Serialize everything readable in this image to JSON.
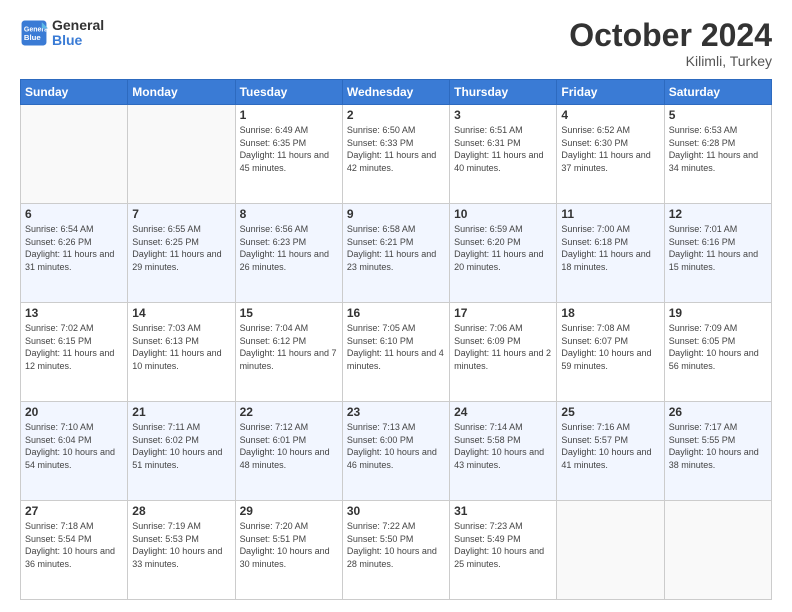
{
  "logo": {
    "line1": "General",
    "line2": "Blue"
  },
  "header": {
    "month": "October 2024",
    "location": "Kilimli, Turkey"
  },
  "days_of_week": [
    "Sunday",
    "Monday",
    "Tuesday",
    "Wednesday",
    "Thursday",
    "Friday",
    "Saturday"
  ],
  "weeks": [
    [
      {
        "day": "",
        "info": ""
      },
      {
        "day": "",
        "info": ""
      },
      {
        "day": "1",
        "info": "Sunrise: 6:49 AM\nSunset: 6:35 PM\nDaylight: 11 hours and 45 minutes."
      },
      {
        "day": "2",
        "info": "Sunrise: 6:50 AM\nSunset: 6:33 PM\nDaylight: 11 hours and 42 minutes."
      },
      {
        "day": "3",
        "info": "Sunrise: 6:51 AM\nSunset: 6:31 PM\nDaylight: 11 hours and 40 minutes."
      },
      {
        "day": "4",
        "info": "Sunrise: 6:52 AM\nSunset: 6:30 PM\nDaylight: 11 hours and 37 minutes."
      },
      {
        "day": "5",
        "info": "Sunrise: 6:53 AM\nSunset: 6:28 PM\nDaylight: 11 hours and 34 minutes."
      }
    ],
    [
      {
        "day": "6",
        "info": "Sunrise: 6:54 AM\nSunset: 6:26 PM\nDaylight: 11 hours and 31 minutes."
      },
      {
        "day": "7",
        "info": "Sunrise: 6:55 AM\nSunset: 6:25 PM\nDaylight: 11 hours and 29 minutes."
      },
      {
        "day": "8",
        "info": "Sunrise: 6:56 AM\nSunset: 6:23 PM\nDaylight: 11 hours and 26 minutes."
      },
      {
        "day": "9",
        "info": "Sunrise: 6:58 AM\nSunset: 6:21 PM\nDaylight: 11 hours and 23 minutes."
      },
      {
        "day": "10",
        "info": "Sunrise: 6:59 AM\nSunset: 6:20 PM\nDaylight: 11 hours and 20 minutes."
      },
      {
        "day": "11",
        "info": "Sunrise: 7:00 AM\nSunset: 6:18 PM\nDaylight: 11 hours and 18 minutes."
      },
      {
        "day": "12",
        "info": "Sunrise: 7:01 AM\nSunset: 6:16 PM\nDaylight: 11 hours and 15 minutes."
      }
    ],
    [
      {
        "day": "13",
        "info": "Sunrise: 7:02 AM\nSunset: 6:15 PM\nDaylight: 11 hours and 12 minutes."
      },
      {
        "day": "14",
        "info": "Sunrise: 7:03 AM\nSunset: 6:13 PM\nDaylight: 11 hours and 10 minutes."
      },
      {
        "day": "15",
        "info": "Sunrise: 7:04 AM\nSunset: 6:12 PM\nDaylight: 11 hours and 7 minutes."
      },
      {
        "day": "16",
        "info": "Sunrise: 7:05 AM\nSunset: 6:10 PM\nDaylight: 11 hours and 4 minutes."
      },
      {
        "day": "17",
        "info": "Sunrise: 7:06 AM\nSunset: 6:09 PM\nDaylight: 11 hours and 2 minutes."
      },
      {
        "day": "18",
        "info": "Sunrise: 7:08 AM\nSunset: 6:07 PM\nDaylight: 10 hours and 59 minutes."
      },
      {
        "day": "19",
        "info": "Sunrise: 7:09 AM\nSunset: 6:05 PM\nDaylight: 10 hours and 56 minutes."
      }
    ],
    [
      {
        "day": "20",
        "info": "Sunrise: 7:10 AM\nSunset: 6:04 PM\nDaylight: 10 hours and 54 minutes."
      },
      {
        "day": "21",
        "info": "Sunrise: 7:11 AM\nSunset: 6:02 PM\nDaylight: 10 hours and 51 minutes."
      },
      {
        "day": "22",
        "info": "Sunrise: 7:12 AM\nSunset: 6:01 PM\nDaylight: 10 hours and 48 minutes."
      },
      {
        "day": "23",
        "info": "Sunrise: 7:13 AM\nSunset: 6:00 PM\nDaylight: 10 hours and 46 minutes."
      },
      {
        "day": "24",
        "info": "Sunrise: 7:14 AM\nSunset: 5:58 PM\nDaylight: 10 hours and 43 minutes."
      },
      {
        "day": "25",
        "info": "Sunrise: 7:16 AM\nSunset: 5:57 PM\nDaylight: 10 hours and 41 minutes."
      },
      {
        "day": "26",
        "info": "Sunrise: 7:17 AM\nSunset: 5:55 PM\nDaylight: 10 hours and 38 minutes."
      }
    ],
    [
      {
        "day": "27",
        "info": "Sunrise: 7:18 AM\nSunset: 5:54 PM\nDaylight: 10 hours and 36 minutes."
      },
      {
        "day": "28",
        "info": "Sunrise: 7:19 AM\nSunset: 5:53 PM\nDaylight: 10 hours and 33 minutes."
      },
      {
        "day": "29",
        "info": "Sunrise: 7:20 AM\nSunset: 5:51 PM\nDaylight: 10 hours and 30 minutes."
      },
      {
        "day": "30",
        "info": "Sunrise: 7:22 AM\nSunset: 5:50 PM\nDaylight: 10 hours and 28 minutes."
      },
      {
        "day": "31",
        "info": "Sunrise: 7:23 AM\nSunset: 5:49 PM\nDaylight: 10 hours and 25 minutes."
      },
      {
        "day": "",
        "info": ""
      },
      {
        "day": "",
        "info": ""
      }
    ]
  ]
}
